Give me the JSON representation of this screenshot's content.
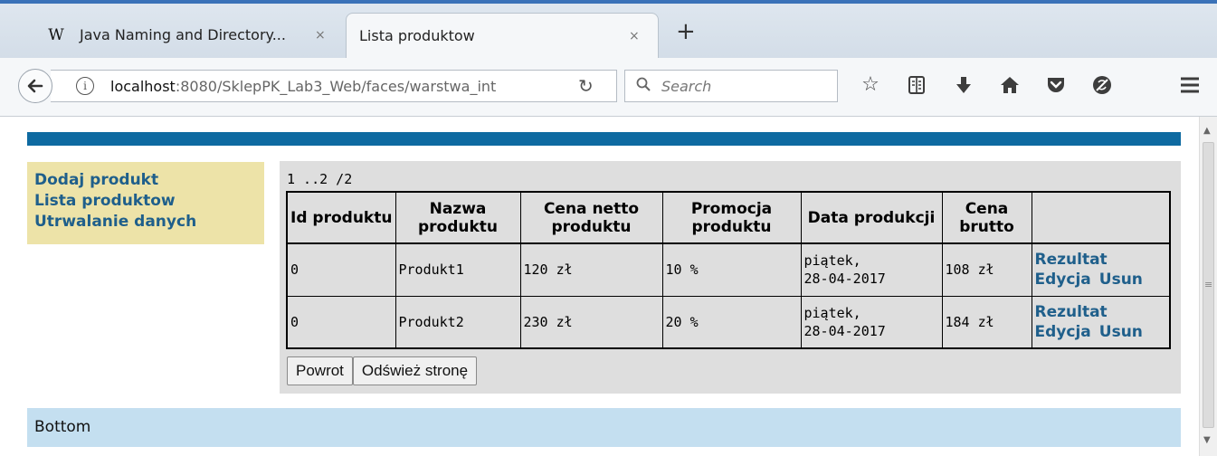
{
  "browser": {
    "tabs": [
      {
        "favicon": "W",
        "title": "Java Naming and Directory...",
        "close": "×"
      },
      {
        "title": "Lista produktow",
        "close": "×"
      }
    ],
    "new_tab": "+",
    "nav": {
      "back": "🡐",
      "info": "i",
      "url_host": "localhost",
      "url_rest": ":8080/SklepPK_Lab3_Web/faces/warstwa_int",
      "reload": "↻",
      "search_icon": "⚲",
      "search_placeholder": "Search"
    },
    "toolbar_icons": {
      "bookmark": "☆",
      "reader": "▤",
      "downloads": "⬇",
      "home": "⌂",
      "pocket": "⛉",
      "no_tracking": "⊘",
      "menu": "☰"
    }
  },
  "side_menu": {
    "items": [
      "Dodaj produkt",
      "Lista produktow",
      "Utrwalanie danych"
    ]
  },
  "pager": "1 ..2 /2",
  "table": {
    "headers": [
      "Id produktu",
      "Nazwa produktu",
      "Cena netto produktu",
      "Promocja produktu",
      "Data produkcji",
      "Cena brutto",
      ""
    ],
    "rows": [
      {
        "id": "0",
        "name": "Produkt1",
        "net": "120 zł",
        "promo": "10 %",
        "date_day": "piątek,",
        "date": "28-04-2017",
        "gross": "108 zł",
        "result": "Rezultat",
        "edit": "Edycja",
        "delete": "Usun"
      },
      {
        "id": "0",
        "name": "Produkt2",
        "net": "230 zł",
        "promo": "20 %",
        "date_day": "piątek,",
        "date": "28-04-2017",
        "gross": "184 zł",
        "result": "Rezultat",
        "edit": "Edycja",
        "delete": "Usun"
      }
    ]
  },
  "buttons": {
    "back": "Powrot",
    "refresh": "Odśwież stronę"
  },
  "footer": "Bottom",
  "colors": {
    "top_band": "#0e6aa1",
    "side_menu": "#ede3a8",
    "links": "#1f5f8b",
    "footer": "#c4dff0",
    "panel": "#dedede"
  }
}
